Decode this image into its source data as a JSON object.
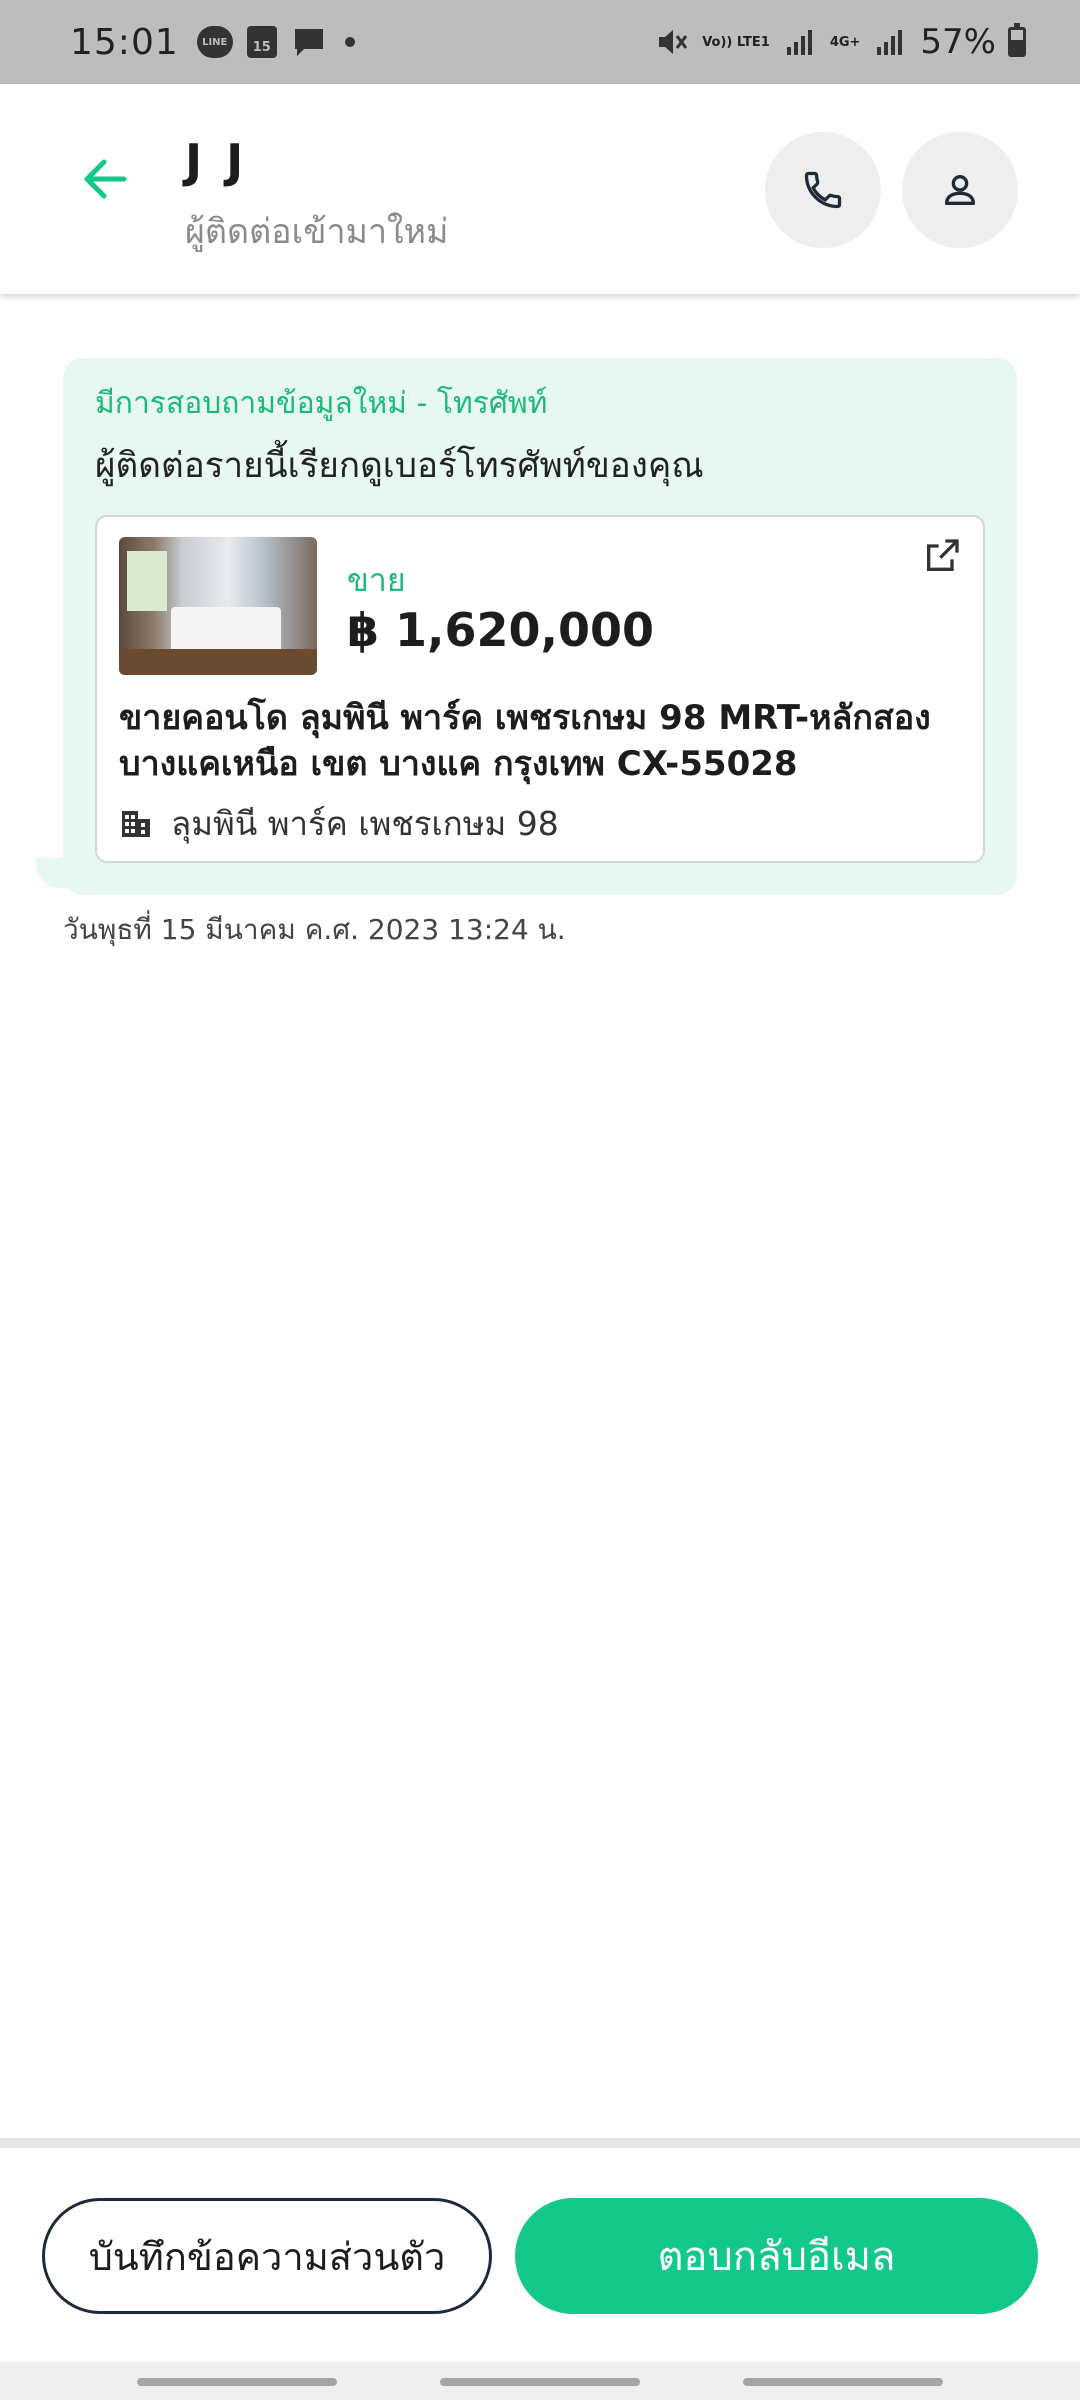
{
  "status_bar": {
    "time": "15:01",
    "calendar_day": "15",
    "line_app": "LINE",
    "net_lte": "Vo)) LTE1",
    "net_4g": "4G+",
    "battery": "57%",
    "battery_level": 0.57
  },
  "header": {
    "title": "J J",
    "subtitle": "ผู้ติดต่อเข้ามาใหม่"
  },
  "message": {
    "heading": "มีการสอบถามข้อมูลใหม่ - โทรศัพท์",
    "text": "ผู้ติดต่อรายนี้เรียกดูเบอร์โทรศัพท์ของคุณ",
    "timestamp": "วันพุธที่ 15 มีนาคม ค.ศ. 2023 13:24 น."
  },
  "listing": {
    "sale_label": "ขาย",
    "price": "฿ 1,620,000",
    "title": "ขายคอนโด  ลุมพินี พาร์ค เพชรเกษม 98  MRT-หลักสอง บางแคเหนือ เขต บางแค กรุงเทพ CX-55028",
    "project": "ลุมพินี พาร์ค เพชรเกษม 98"
  },
  "actions": {
    "note_label": "บันทึกข้อความส่วนตัว",
    "reply_label": "ตอบกลับอีเมล"
  },
  "icons": {
    "back": "arrow-left-icon",
    "call": "phone-icon",
    "profile": "person-icon",
    "external": "external-link-icon",
    "building": "building-icon"
  },
  "colors": {
    "accent": "#12c98a",
    "accent_text": "#1cb97d",
    "bubble": "#e6f8f1"
  }
}
